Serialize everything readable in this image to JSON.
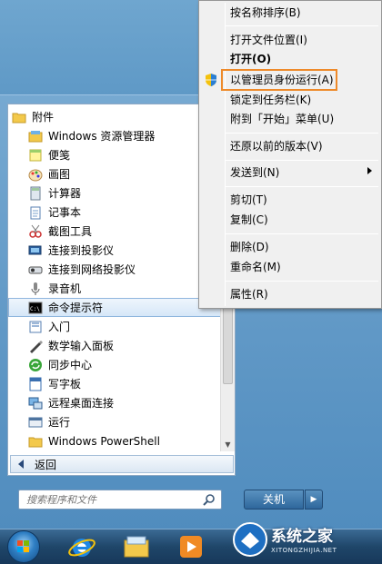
{
  "start_menu": {
    "folder_label": "附件",
    "items": [
      {
        "label": "Windows 资源管理器",
        "icon": "explorer-icon"
      },
      {
        "label": "便笺",
        "icon": "sticky-notes-icon"
      },
      {
        "label": "画图",
        "icon": "paint-icon"
      },
      {
        "label": "计算器",
        "icon": "calculator-icon"
      },
      {
        "label": "记事本",
        "icon": "notepad-icon"
      },
      {
        "label": "截图工具",
        "icon": "snipping-tool-icon"
      },
      {
        "label": "连接到投影仪",
        "icon": "projector-icon"
      },
      {
        "label": "连接到网络投影仪",
        "icon": "network-projector-icon"
      },
      {
        "label": "录音机",
        "icon": "sound-recorder-icon"
      },
      {
        "label": "命令提示符",
        "icon": "command-prompt-icon"
      },
      {
        "label": "入门",
        "icon": "getting-started-icon"
      },
      {
        "label": "数学输入面板",
        "icon": "math-input-icon"
      },
      {
        "label": "同步中心",
        "icon": "sync-center-icon"
      },
      {
        "label": "写字板",
        "icon": "wordpad-icon"
      },
      {
        "label": "远程桌面连接",
        "icon": "remote-desktop-icon"
      },
      {
        "label": "运行",
        "icon": "run-icon"
      },
      {
        "label": "Windows PowerShell",
        "icon": "folder-icon"
      }
    ],
    "back_label": "返回",
    "search_placeholder": "搜索程序和文件",
    "shutdown_label": "关机"
  },
  "context_menu": {
    "items": [
      {
        "label": "按名称排序(B)"
      },
      {
        "label": "打开文件位置(I)"
      },
      {
        "label": "打开(O)"
      },
      {
        "label": "以管理员身份运行(A)"
      },
      {
        "label": "锁定到任务栏(K)"
      },
      {
        "label": "附到「开始」菜单(U)"
      },
      {
        "label": "还原以前的版本(V)"
      },
      {
        "label": "发送到(N)"
      },
      {
        "label": "剪切(T)"
      },
      {
        "label": "复制(C)"
      },
      {
        "label": "删除(D)"
      },
      {
        "label": "重命名(M)"
      },
      {
        "label": "属性(R)"
      }
    ]
  },
  "watermark": {
    "title": "系统之家",
    "url": "XITONGZHIJIA.NET"
  },
  "colors": {
    "highlight_box": "#ee8a2a",
    "selected_row": "#d6e7f8",
    "taskbar": "#1f4669"
  }
}
